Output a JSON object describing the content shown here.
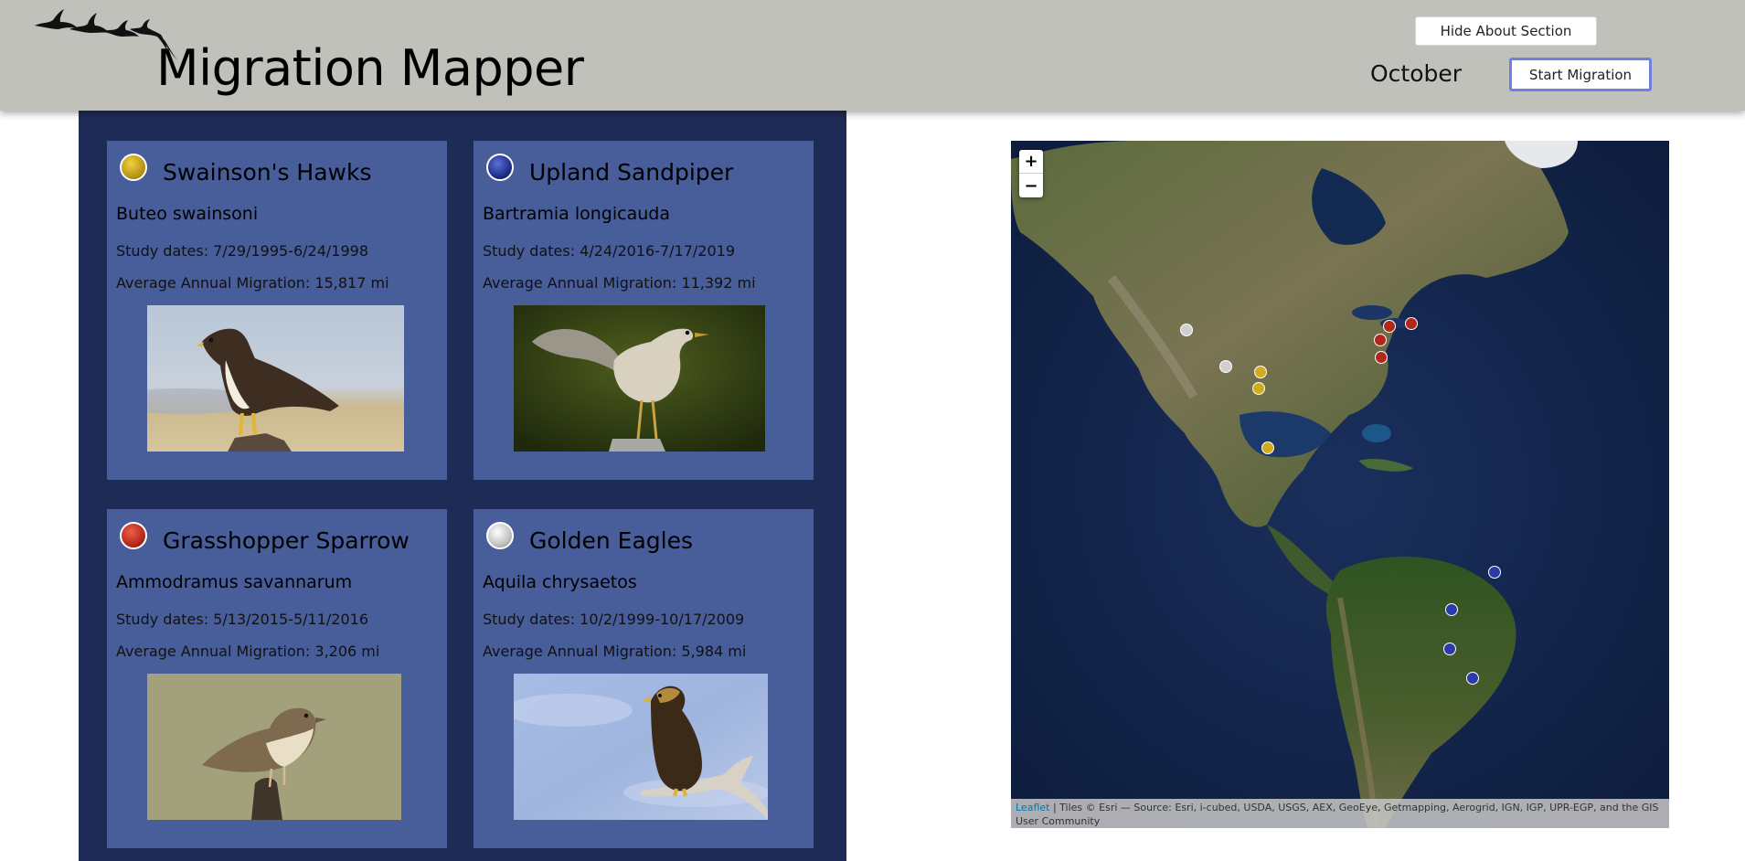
{
  "header": {
    "title": "Migration Mapper",
    "hide_about_label": "Hide About Section",
    "month": "October",
    "start_label": "Start Migration"
  },
  "species": [
    {
      "name": "Swainson's Hawks",
      "scientific": "Buteo swainsoni",
      "dates": "Study dates: 7/29/1995-6/24/1998",
      "avg": "Average Annual Migration: 15,817 mi",
      "color": "#c9a81c"
    },
    {
      "name": "Upland Sandpiper",
      "scientific": "Bartramia longicauda",
      "dates": "Study dates: 4/24/2016-7/17/2019",
      "avg": "Average Annual Migration: 11,392 mi",
      "color": "#1f2f8c"
    },
    {
      "name": "Grasshopper Sparrow",
      "scientific": "Ammodramus savannarum",
      "dates": "Study dates: 5/13/2015-5/11/2016",
      "avg": "Average Annual Migration: 3,206 mi",
      "color": "#b3261a"
    },
    {
      "name": "Golden Eagles",
      "scientific": "Aquila chrysaetos",
      "dates": "Study dates: 10/2/1999-10/17/2009",
      "avg": "Average Annual Migration: 5,984 mi",
      "color": "#c8c8c8"
    }
  ],
  "map": {
    "zoom_in": "+",
    "zoom_out": "−",
    "attribution_link": "Leaflet",
    "attribution_text": " | Tiles © Esri — Source: Esri, i-cubed, USDA, USGS, AEX, GeoEye, Getmapping, Aerogrid, IGN, IGP, UPR-EGP, and the GIS User Community"
  },
  "icons": {
    "birds_logo": "flying-birds-logo",
    "species_dot": "species-color-dot-icon"
  }
}
